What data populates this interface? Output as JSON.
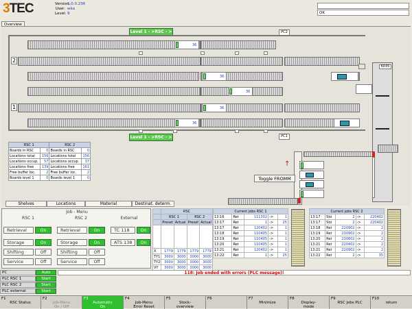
{
  "header": {
    "logo_digit": "3",
    "logo_text": "TEC",
    "version_label": "Version:",
    "version": "1.0.0.236",
    "user_label": "User:",
    "user": "wka",
    "level_label": "Level:",
    "level": "9",
    "status_right": "OK"
  },
  "tabs": {
    "overview": "Overview"
  },
  "overview": {
    "level1_top": "Level 1 - >RSC - >",
    "level1_bottom": "Level 1 - >RSC - >",
    "pc2": "PC2",
    "pc1": "PC1",
    "row2": "2",
    "row1": "1",
    "toggle": "Toggle FROMM",
    "lift_label": "6035",
    "box_nums": [
      "36",
      "36",
      "36",
      "36",
      "36"
    ]
  },
  "rsc_info": {
    "h1": "RSC 1",
    "h2": "RSC 2",
    "rows": [
      [
        "Boards in RSC",
        "0",
        "Boards in RSC",
        "0"
      ],
      [
        "Locations total",
        "156",
        "Locations total",
        "156"
      ],
      [
        "Locations occup.",
        "57",
        "Locations occup.",
        "37"
      ],
      [
        "Locations free",
        "139",
        "Locations free",
        "161"
      ],
      [
        "Free buffer loc.",
        "2",
        "Free buffer loc.",
        "2"
      ],
      [
        "Boards level 1",
        "0",
        "Boards level 1",
        "0"
      ]
    ]
  },
  "bottom_tabs": [
    "Shelves",
    "Locations",
    "Material",
    "Destinat. determ."
  ],
  "job_menu": {
    "title": "Job - Menu",
    "rsc1": "RSC 1",
    "rsc2": "RSC 2",
    "external": "External",
    "rows": [
      {
        "label": "Retrieval",
        "state": "On"
      },
      {
        "label": "Storage",
        "state": "On"
      },
      {
        "label": "Shifting",
        "state": "Off"
      },
      {
        "label": "Service",
        "state": "Off"
      }
    ],
    "rows2": [
      {
        "label": "Retrieval",
        "state": "On"
      },
      {
        "label": "Storage",
        "state": "On"
      },
      {
        "label": "Shifting",
        "state": "Off"
      },
      {
        "label": "Service",
        "state": "Off"
      }
    ],
    "ext": [
      {
        "label": "TC 118",
        "state": "On"
      },
      {
        "label": "ATS 138",
        "state": "On"
      }
    ]
  },
  "rsc_pos": {
    "title": "RSC",
    "rsc1": "RSC 1",
    "rsc2": "RSC 2",
    "cols": [
      "Preset",
      "Actual",
      "Preset",
      "Actual"
    ],
    "rows": [
      [
        "X",
        "1779",
        "1779",
        "1779",
        "1779"
      ],
      [
        "TY1",
        "3000",
        "3000",
        "3000",
        "3000"
      ],
      [
        "TY2",
        "3000",
        "3000",
        "3000",
        "3000"
      ],
      [
        "VY",
        "3000",
        "3000",
        "3000",
        "3000"
      ],
      [
        "VZ",
        "1000",
        "1000",
        "1000",
        "1001"
      ]
    ]
  },
  "jobs1": {
    "title": "Current jobs RSC 1",
    "rows": [
      [
        "13:16",
        "Ret",
        "111302",
        "->",
        "1"
      ],
      [
        "13:17",
        "Ret",
        "1",
        "->",
        "25"
      ],
      [
        "13:17",
        "Ret",
        "120402",
        "->",
        "1"
      ],
      [
        "13:18",
        "Ret",
        "110405",
        "->",
        "1"
      ],
      [
        "13:19",
        "Ret",
        "110405",
        "->",
        "1"
      ],
      [
        "13:20",
        "Ret",
        "110405",
        "->",
        "1"
      ],
      [
        "13:21",
        "Ret",
        "120402",
        "->",
        "1"
      ],
      [
        "13:22",
        "Ret",
        "1",
        "->",
        "25"
      ]
    ]
  },
  "jobs2": {
    "title": "Current jobs RSC 2",
    "rows": [
      [
        "13:17",
        "Sto",
        "2",
        "->",
        "220402"
      ],
      [
        "13:17",
        "Sto",
        "2",
        "->",
        "220402"
      ],
      [
        "13:18",
        "Ret",
        "220902",
        "->",
        "2"
      ],
      [
        "13:19",
        "Ret",
        "210902",
        "->",
        "2"
      ],
      [
        "13:20",
        "Ret",
        "210802",
        "->",
        "2"
      ],
      [
        "13:21",
        "Ret",
        "220402",
        "->",
        "2"
      ],
      [
        "13:21",
        "Ret",
        "220902",
        "->",
        "2"
      ],
      [
        "13:22",
        "Ret",
        "2",
        "->",
        "35"
      ]
    ]
  },
  "status": [
    {
      "label": "PC",
      "value": "Auto"
    },
    {
      "label": "PLC RSC 1",
      "value": "Start"
    },
    {
      "label": "PLC RSC 2",
      "value": "Start"
    },
    {
      "label": "PLC external",
      "value": "Start"
    }
  ],
  "message": "118: Job ended with errors (PLC message)!",
  "fkeys": [
    {
      "key": "F1",
      "label": "RSC Status",
      "state": "normal"
    },
    {
      "key": "F2",
      "label": "Job-Menu\nOn / Off",
      "state": "dim"
    },
    {
      "key": "F3",
      "label": "Automatic\nOn",
      "state": "on"
    },
    {
      "key": "F4",
      "label": "Job-Menu\nError Reset",
      "state": "normal"
    },
    {
      "key": "F5",
      "label": "Stock-\noverview",
      "state": "normal"
    },
    {
      "key": "F6",
      "label": "",
      "state": "normal"
    },
    {
      "key": "F7",
      "label": "Minimize",
      "state": "normal"
    },
    {
      "key": "F8",
      "label": "Display-\nmode",
      "state": "normal"
    },
    {
      "key": "F9",
      "label": "RSC jobs PLC",
      "state": "normal"
    },
    {
      "key": "F10",
      "label": "return",
      "state": "normal"
    }
  ]
}
